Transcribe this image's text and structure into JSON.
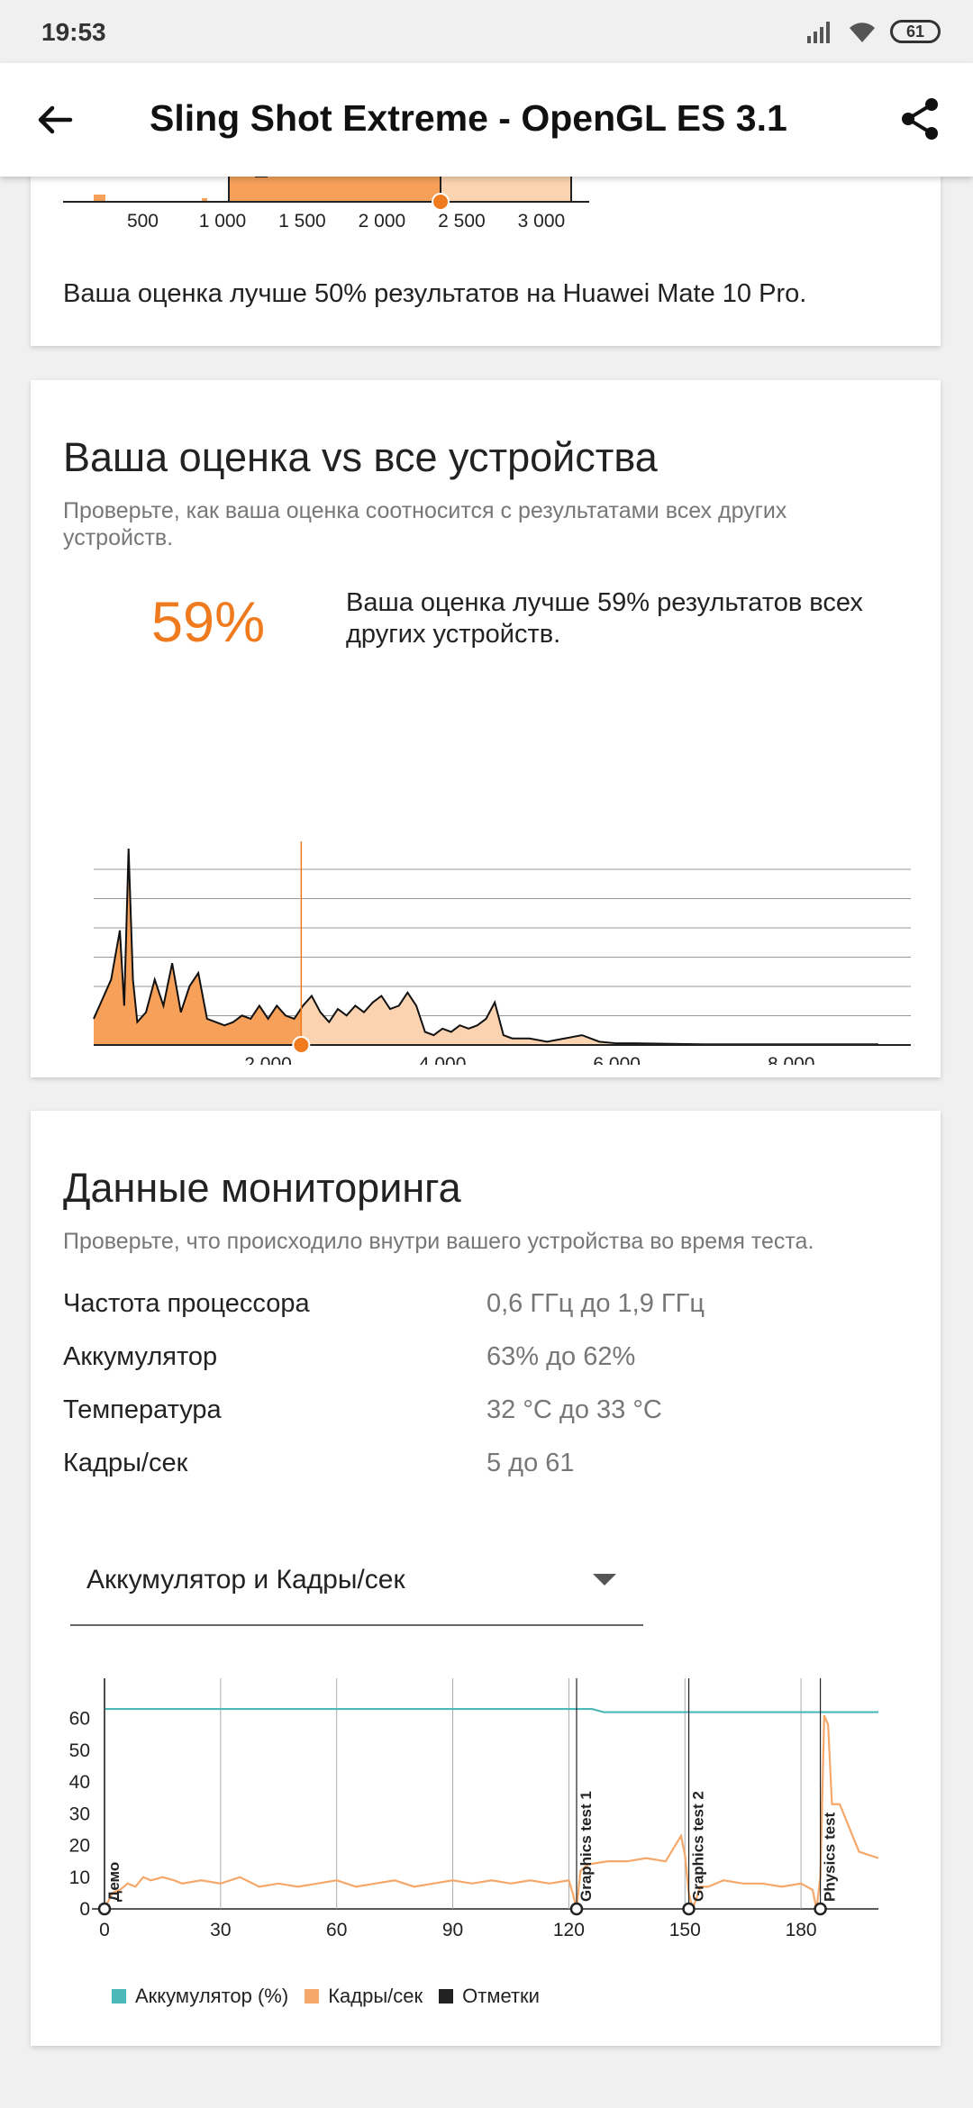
{
  "status": {
    "time": "19:53",
    "battery": "61"
  },
  "app_bar": {
    "title": "Sling Shot Extreme - OpenGL ES 3.1",
    "back_icon": "arrow-back-icon",
    "share_icon": "share-icon"
  },
  "card1": {
    "text": "Ваша оценка лучше 50% результатов на Huawei Mate 10 Pro.",
    "x_ticks": [
      "500",
      "1 000",
      "1 500",
      "2 000",
      "2 500",
      "3 000"
    ]
  },
  "card2": {
    "title": "Ваша оценка vs все устройства",
    "subtitle": "Проверьте, как ваша оценка соотносится с результатами всех других устройств.",
    "percent": "59%",
    "percent_text": "Ваша оценка лучше 59% результатов всех других устройств.",
    "x_ticks": [
      "2 000",
      "4 000",
      "6 000",
      "8 000"
    ]
  },
  "card3": {
    "title": "Данные мониторинга",
    "subtitle": "Проверьте, что происходило внутри вашего устройства во время теста.",
    "rows": [
      {
        "label": "Частота процессора",
        "value": "0,6 ГГц до 1,9 ГГц"
      },
      {
        "label": "Аккумулятор",
        "value": "63% до 62%"
      },
      {
        "label": "Температура",
        "value": "32 °C до 33 °C"
      },
      {
        "label": "Кадры/сек",
        "value": "5 до 61"
      }
    ],
    "dropdown": {
      "value": "Аккумулятор и Кадры/сек"
    },
    "legend": [
      {
        "label": "Аккумулятор (%)",
        "color": "#4db8b8"
      },
      {
        "label": "Кадры/сек",
        "color": "#f6a86a"
      },
      {
        "label": "Отметки",
        "color": "#222222"
      }
    ],
    "markers": [
      {
        "label": "Демо",
        "x": 0
      },
      {
        "label": "Graphics test 1",
        "x": 122
      },
      {
        "label": "Graphics test 2",
        "x": 151
      },
      {
        "label": "Physics test",
        "x": 185
      }
    ]
  },
  "colors": {
    "accent": "#f07a1e",
    "fill_dark": "#f6a05a",
    "fill_light": "#fbd3b0",
    "battery_line": "#4db8b8",
    "fps_line": "#f6a86a"
  },
  "chart_data": [
    {
      "type": "area",
      "xlim": [
        0,
        3300
      ],
      "x_ticks": [
        500,
        1000,
        1500,
        2000,
        2500,
        3000
      ],
      "user_score_x": 2400,
      "note": "top of histogram cropped by scroll"
    },
    {
      "type": "area",
      "xlim": [
        0,
        9000
      ],
      "x_ticks": [
        2000,
        4000,
        6000,
        8000
      ],
      "user_score_x": 2380,
      "x": [
        0,
        100,
        200,
        300,
        350,
        400,
        450,
        500,
        600,
        700,
        800,
        900,
        1000,
        1100,
        1200,
        1300,
        1400,
        1500,
        1600,
        1700,
        1800,
        1900,
        2000,
        2100,
        2200,
        2300,
        2400,
        2500,
        2600,
        2700,
        2800,
        2900,
        3000,
        3100,
        3200,
        3300,
        3400,
        3500,
        3600,
        3700,
        3800,
        3900,
        4000,
        4100,
        4200,
        4300,
        4400,
        4500,
        4600,
        4700,
        4800,
        5000,
        5200,
        5400,
        5600,
        5800,
        6000,
        6200,
        7000,
        8000,
        9000
      ],
      "values": [
        8,
        14,
        20,
        35,
        12,
        60,
        20,
        7,
        10,
        20,
        12,
        25,
        10,
        18,
        22,
        8,
        7,
        6,
        7,
        9,
        8,
        12,
        8,
        12,
        9,
        8,
        12,
        15,
        10,
        7,
        11,
        9,
        12,
        10,
        13,
        15,
        11,
        12,
        16,
        12,
        4,
        3,
        5,
        4,
        6,
        5,
        6,
        8,
        13,
        3,
        2,
        2,
        1,
        2,
        3,
        1,
        0.5,
        0.5,
        0.2,
        0.2,
        0.2
      ],
      "grid": true
    },
    {
      "type": "line",
      "title": "",
      "xlabel": "",
      "ylabel": "",
      "xlim": [
        0,
        200
      ],
      "ylim": [
        0,
        65
      ],
      "x_ticks": [
        0,
        30,
        60,
        90,
        120,
        150,
        180
      ],
      "y_ticks": [
        0,
        10,
        20,
        30,
        40,
        50,
        60
      ],
      "series": [
        {
          "name": "Аккумулятор (%)",
          "x": [
            0,
            126,
            129,
            200
          ],
          "values": [
            63,
            63,
            62,
            62
          ]
        },
        {
          "name": "Кадры/сек",
          "x": [
            0,
            2,
            4,
            6,
            8,
            10,
            12,
            15,
            18,
            20,
            25,
            30,
            35,
            40,
            45,
            50,
            55,
            60,
            65,
            70,
            75,
            80,
            85,
            90,
            95,
            100,
            105,
            110,
            115,
            120,
            121,
            122,
            123,
            125,
            130,
            135,
            140,
            145,
            149,
            150,
            151,
            152,
            154,
            156,
            160,
            165,
            170,
            175,
            180,
            183,
            184,
            185,
            186,
            187,
            188,
            190,
            195,
            200
          ],
          "values": [
            0,
            5,
            6,
            8,
            7,
            10,
            9,
            10,
            9,
            8,
            9,
            8,
            10,
            7,
            8,
            7,
            8,
            9,
            7,
            8,
            9,
            7,
            8,
            9,
            8,
            9,
            8,
            9,
            8,
            9,
            5,
            0,
            12,
            14,
            15,
            15,
            16,
            15,
            23,
            17,
            5,
            0,
            7,
            7,
            9,
            8,
            8,
            7,
            8,
            6,
            0,
            10,
            61,
            58,
            33,
            33,
            18,
            16
          ]
        }
      ],
      "legend_position": "bottom-left"
    }
  ]
}
